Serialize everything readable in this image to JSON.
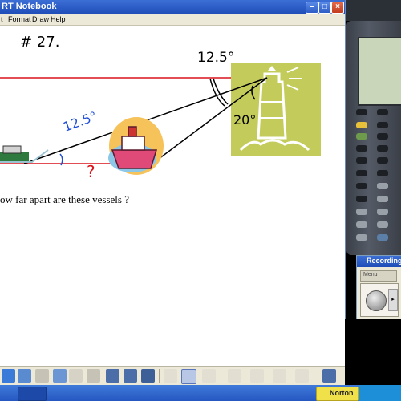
{
  "window": {
    "title": "RT Notebook"
  },
  "menu": {
    "items": [
      "t",
      "Format",
      "Draw",
      "Help"
    ]
  },
  "page": {
    "problem_number": "# 27.",
    "angle_top": "12.5°",
    "angle_middle": "12.5°",
    "angle_lighthouse": "20°",
    "unknown_mark": "?",
    "question": "ow far apart are these vessels ?"
  },
  "recording": {
    "title": "Recording",
    "menu_label": "Menu"
  },
  "taskbar": {
    "norton_label": "Norton"
  },
  "colors": {
    "red_line": "#d9141b",
    "blue_ink": "#1f4fd6",
    "lighthouse_bg": "#c3cc5a",
    "titlebar": "#2a5bc8"
  }
}
